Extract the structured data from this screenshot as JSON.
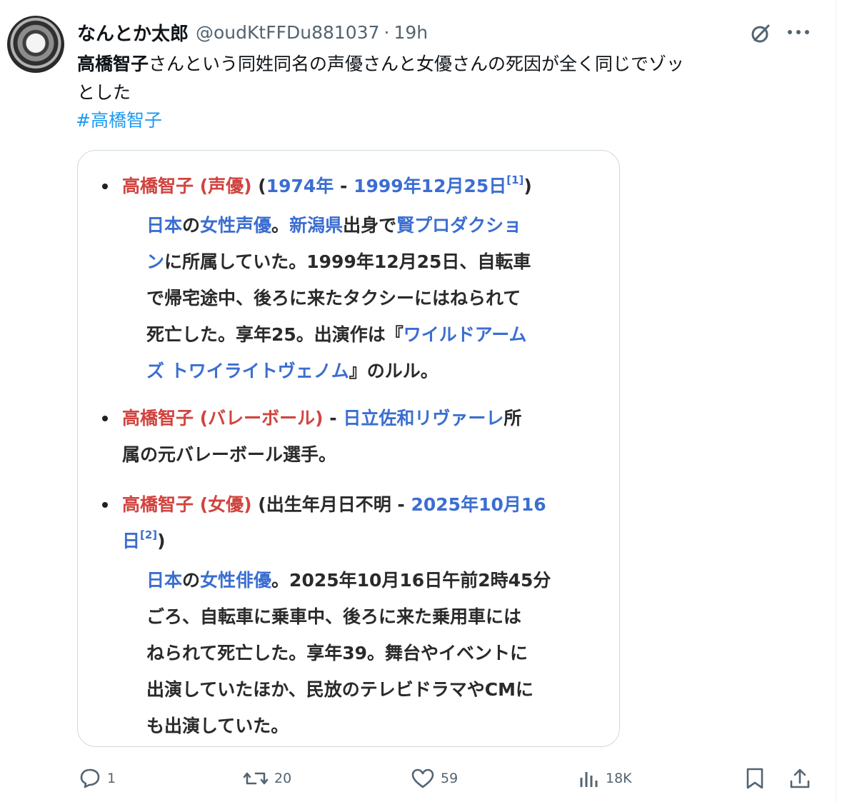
{
  "post": {
    "display_name": "なんとか太郎",
    "handle": "@oudKtFFDu881037",
    "separator": "·",
    "time": "19h",
    "text_bold": "高橋智子",
    "text_rest_1": "さんという同姓同名の声優さんと女優さんの死因が全く同じでゾッ",
    "text_rest_2": "とした",
    "hashtag": "#高橋智子"
  },
  "icons": {
    "menu": [
      "grok-icon",
      "more-icon"
    ],
    "actions": [
      "reply-icon",
      "retweet-icon",
      "like-icon",
      "views-icon",
      "bookmark-icon",
      "share-icon"
    ]
  },
  "card": {
    "entry1": {
      "l1": {
        "name": "高橋智子 (声優)",
        "open": " (",
        "start": "1974年",
        "sep": " - ",
        "end": "1999年12月25日",
        "ref": "[1]",
        "close": ")"
      },
      "l2": {
        "a": "日本",
        "b": "の",
        "c": "女性声優",
        "d": "。",
        "e": "新潟県",
        "f": "出身で",
        "g": "賢プロダクショ"
      },
      "l3": {
        "a": "ン",
        "b": "に所属していた。1999年12月25日、自転車"
      },
      "l4": "で帰宅途中、後ろに来たタクシーにはねられて",
      "l5": {
        "a": "死亡した。享年25。出演作は『",
        "b": "ワイルドアーム"
      },
      "l6": {
        "a": "ズ トワイライトヴェノム",
        "b": "』のルル。"
      }
    },
    "entry2": {
      "l1": {
        "name": "高橋智子 (バレーボール)",
        "sep": " - ",
        "team": "日立佐和リヴァーレ",
        "suffix": "所"
      },
      "l2": "属の元バレーボール選手。"
    },
    "entry3": {
      "l1": {
        "name": "高橋智子 (女優)",
        "open": " (出生年月日不明",
        "sep": " - ",
        "date": "2025年10月16"
      },
      "l2": {
        "date": "日",
        "ref": "[2]",
        "close": ")"
      },
      "l3": {
        "a": "日本",
        "b": "の",
        "c": "女性俳優",
        "d": "。2025年10月16日午前2時45分"
      },
      "l4": "ごろ、自転車に乗車中、後ろに来た乗用車には",
      "l5": "ねられて死亡した。享年39。舞台やイベントに",
      "l6": "出演していたほか、民放のテレビドラマやCMに",
      "l7": "も出演していた。"
    }
  },
  "actions": {
    "replies": "1",
    "reposts": "20",
    "likes": "59",
    "views": "18K"
  }
}
